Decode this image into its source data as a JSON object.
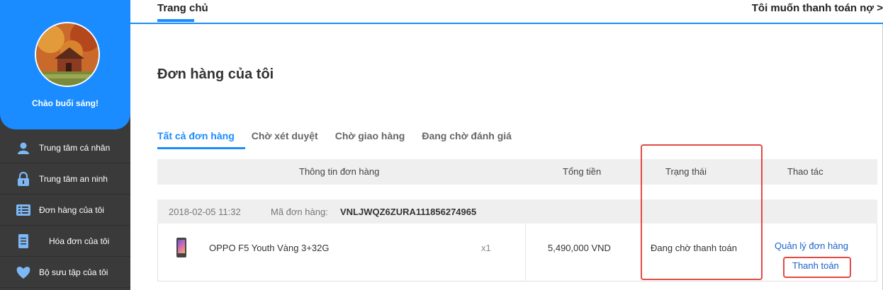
{
  "sidebar": {
    "greeting": "Chào buổi sáng!",
    "items": [
      {
        "label": "Trung tâm cá nhân",
        "icon": "user-icon"
      },
      {
        "label": "Trung tâm an ninh",
        "icon": "lock-icon"
      },
      {
        "label": "Đơn hàng của tôi",
        "icon": "list-icon"
      },
      {
        "label": "Hóa đơn của tôi",
        "icon": "invoice-icon"
      },
      {
        "label": "Bộ sưu tập của tôi",
        "icon": "heart-icon"
      }
    ]
  },
  "topbar": {
    "home_tab": "Trang chủ",
    "debt_link": "Tôi muốn thanh toán nợ >"
  },
  "main": {
    "title": "Đơn hàng của tôi",
    "tabs": [
      "Tất cả đơn hàng",
      "Chờ xét duyệt",
      "Chờ giao hàng",
      "Đang chờ đánh giá"
    ],
    "table_headers": {
      "info": "Thông tin đơn hàng",
      "total": "Tổng tiền",
      "status": "Trạng thái",
      "actions": "Thao tác"
    },
    "order": {
      "date": "2018-02-05 11:32",
      "code_label": "Mã đơn hàng:",
      "code": "VNLJWQZ6ZURA111856274965",
      "product": "OPPO F5 Youth Vàng 3+32G",
      "qty": "x1",
      "total": "5,490,000 VND",
      "status": "Đang chờ thanh toán",
      "manage_link": "Quản lý đơn hàng",
      "pay_link": "Thanh toán"
    }
  },
  "colors": {
    "accent": "#1a8cff",
    "sidebar_bg": "#3a3a3a",
    "highlight": "#e24a44"
  }
}
